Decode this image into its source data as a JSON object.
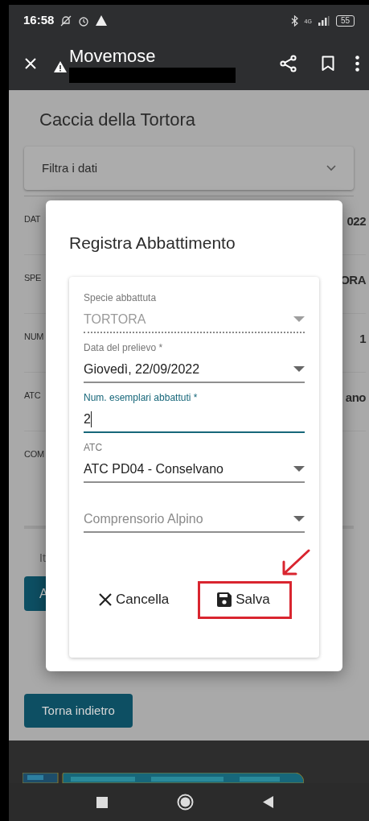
{
  "status_bar": {
    "time": "16:58",
    "network": "4G",
    "battery": "55"
  },
  "app_bar": {
    "title": "Movemose"
  },
  "page": {
    "title": "Caccia della Tortora",
    "filter": {
      "label": "Filtra i dati",
      "expanded": false
    },
    "rows": [
      {
        "label": "DAT",
        "value": "022"
      },
      {
        "label": "SPE",
        "value": "ORA"
      },
      {
        "label": "NUM",
        "value": "1"
      },
      {
        "label": "ATC",
        "value": "ano"
      },
      {
        "label": "COM"
      }
    ],
    "note": "It",
    "action_button": "A",
    "back_button": "Torna indietro"
  },
  "dialog": {
    "title": "Registra Abbattimento",
    "fields": [
      {
        "kind": "select",
        "label": "Specie abbattuta",
        "value": "TORTORA",
        "disabled": true,
        "focused": false
      },
      {
        "kind": "select",
        "label": "Data del prelievo *",
        "value": "Giovedì, 22/09/2022",
        "disabled": false,
        "focused": false
      },
      {
        "kind": "input",
        "label": "Num. esemplari abbattuti *",
        "value": "2",
        "disabled": false,
        "focused": true
      },
      {
        "kind": "select",
        "label": "ATC",
        "value": "ATC PD04 - Conselvano",
        "disabled": false,
        "focused": false
      },
      {
        "kind": "select",
        "placeholder": "Comprensorio Alpino",
        "disabled": false,
        "focused": false
      }
    ],
    "buttons": [
      {
        "kind": "cancel",
        "label": "Cancella",
        "highlighted": false
      },
      {
        "kind": "save",
        "label": "Salva",
        "highlighted": true
      }
    ]
  }
}
